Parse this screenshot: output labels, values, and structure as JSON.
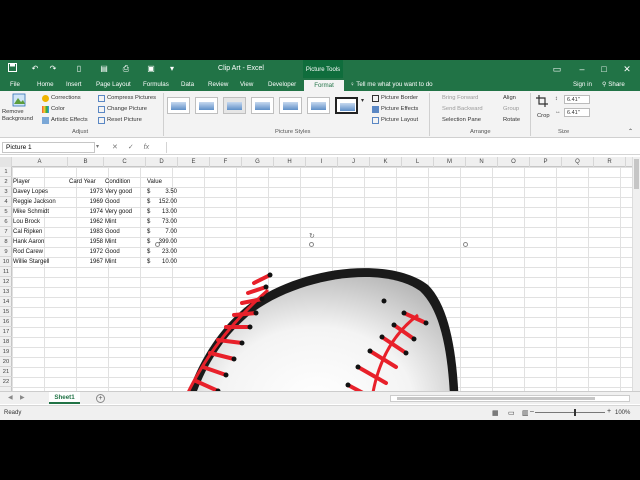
{
  "titlebar": {
    "title": "Clip Art - Excel",
    "context_tab": "Picture Tools",
    "quick_access": [
      "save-icon",
      "undo-icon",
      "redo-icon",
      "new-icon",
      "print-preview-icon",
      "print-icon",
      "customize-icon"
    ]
  },
  "tabs": {
    "items": [
      "File",
      "Home",
      "Insert",
      "Page Layout",
      "Formulas",
      "Data",
      "Review",
      "View",
      "Developer"
    ],
    "active": "Format",
    "tell_me": "Tell me what you want to do",
    "sign_in": "Sign in",
    "share": "Share"
  },
  "ribbon": {
    "adjust": {
      "remove_bg_line1": "Remove",
      "remove_bg_line2": "Background",
      "corrections": "Corrections",
      "color": "Color",
      "artistic": "Artistic Effects",
      "compress": "Compress Pictures",
      "change": "Change Picture",
      "reset": "Reset Picture",
      "label": "Adjust"
    },
    "styles": {
      "border": "Picture Border",
      "effects": "Picture Effects",
      "layout": "Picture Layout",
      "label": "Picture Styles"
    },
    "arrange": {
      "bring_forward": "Bring Forward",
      "send_backward": "Send Backward",
      "selection_pane": "Selection Pane",
      "align": "Align",
      "group": "Group",
      "rotate": "Rotate",
      "label": "Arrange"
    },
    "size": {
      "crop": "Crop",
      "height": "6.41\"",
      "width": "6.41\"",
      "label": "Size"
    }
  },
  "formula_bar": {
    "name_box": "Picture 1",
    "fx": "fx",
    "value": ""
  },
  "grid": {
    "columns": [
      "A",
      "B",
      "C",
      "D",
      "E",
      "F",
      "G",
      "H",
      "I",
      "J",
      "K",
      "L",
      "M",
      "N",
      "O",
      "P",
      "Q",
      "R"
    ],
    "rows": [
      "1",
      "2",
      "3",
      "4",
      "5",
      "6",
      "7",
      "8",
      "9",
      "10",
      "11",
      "12",
      "13",
      "14",
      "15",
      "16",
      "17",
      "18",
      "19",
      "20",
      "21",
      "22"
    ],
    "headers": {
      "player": "Player",
      "card_year": "Card Year",
      "condition": "Condition",
      "value": "Value"
    },
    "data": [
      {
        "player": "Davey Lopes",
        "year": "1973",
        "cond": "Very good",
        "cur": "$",
        "val": "3.50"
      },
      {
        "player": "Reggie Jackson",
        "year": "1969",
        "cond": "Good",
        "cur": "$",
        "val": "152.00"
      },
      {
        "player": "Mike Schmidt",
        "year": "1974",
        "cond": "Very good",
        "cur": "$",
        "val": "13.00"
      },
      {
        "player": "Lou Brock",
        "year": "1962",
        "cond": "Mint",
        "cur": "$",
        "val": "73.00"
      },
      {
        "player": "Cal Ripken",
        "year": "1983",
        "cond": "Good",
        "cur": "$",
        "val": "7.00"
      },
      {
        "player": "Hank Aaron",
        "year": "1958",
        "cond": "Mint",
        "cur": "$",
        "val": "399.00"
      },
      {
        "player": "Rod Carew",
        "year": "1972",
        "cond": "Good",
        "cur": "$",
        "val": "23.00"
      },
      {
        "player": "Willie Stargell",
        "year": "1967",
        "cond": "Mint",
        "cur": "$",
        "val": "10.00"
      }
    ]
  },
  "sheets": {
    "active": "Sheet1"
  },
  "status": {
    "ready": "Ready",
    "zoom": "100%"
  },
  "colors": {
    "excel_green": "#217346",
    "seam_red": "#e8202a"
  }
}
